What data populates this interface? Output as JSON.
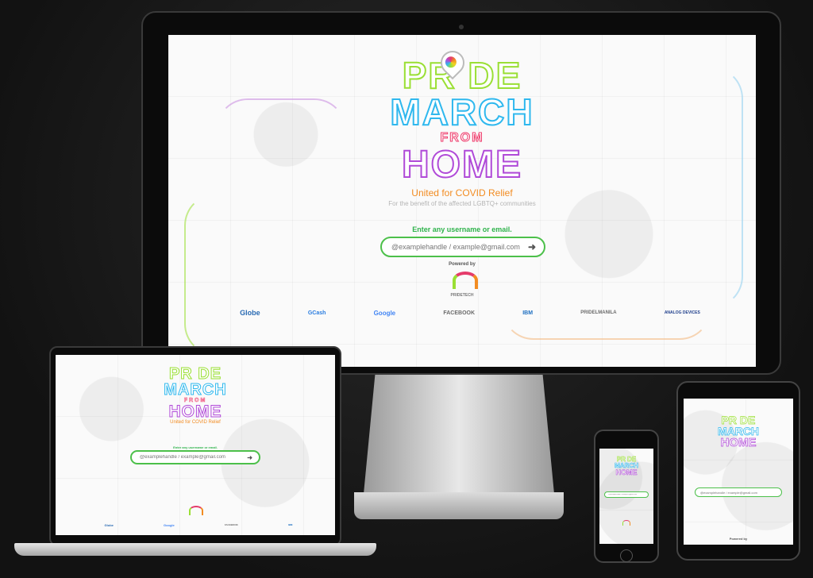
{
  "app": {
    "logo": {
      "line1": "PR DE",
      "line2": "MARCH",
      "line3": "FROM",
      "line4": "HOME"
    },
    "tagline": "United for COVID Relief",
    "subtagline": "For the benefit of the affected LGBTQ+ communities",
    "prompt": "Enter any username or email.",
    "input_placeholder": "@examplehandle / example@gmail.com",
    "submit_icon": "arrow-right-icon",
    "powered_by": "Powered by",
    "powered_brand": "PRIDETECH",
    "sponsors": [
      "Globe",
      "GCash",
      "Google",
      "FACEBOOK",
      "IBM",
      "PRIDELMANILA",
      "ANALOG DEVICES"
    ]
  },
  "colors": {
    "pride": "#9adf34",
    "march": "#2fb8ee",
    "from": "#ee3b6b",
    "home": "#b04ad8",
    "tagline": "#f28c22",
    "prompt": "#2fb34c",
    "field_border": "#4cc04a"
  }
}
